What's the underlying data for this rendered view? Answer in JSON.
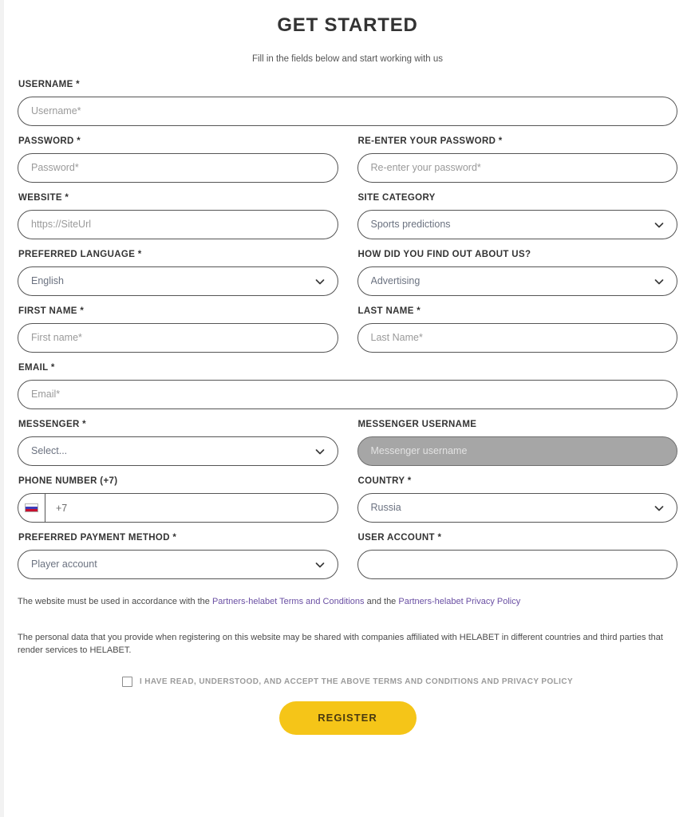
{
  "header": {
    "title": "GET STARTED",
    "subtitle": "Fill in the fields below and start working with us"
  },
  "form": {
    "username": {
      "label": "USERNAME *",
      "placeholder": "Username*",
      "value": ""
    },
    "password": {
      "label": "PASSWORD *",
      "placeholder": "Password*",
      "value": ""
    },
    "password_confirm": {
      "label": "RE-ENTER YOUR PASSWORD *",
      "placeholder": "Re-enter your password*",
      "value": ""
    },
    "website": {
      "label": "WEBSITE *",
      "placeholder": "https://SiteUrl",
      "value": ""
    },
    "site_category": {
      "label": "SITE CATEGORY",
      "value": "Sports predictions",
      "icon": "chevron-down-icon"
    },
    "preferred_language": {
      "label": "PREFERRED LANGUAGE *",
      "value": "English",
      "icon": "chevron-down-icon"
    },
    "find_out": {
      "label": "HOW DID YOU FIND OUT ABOUT US?",
      "value": "Advertising",
      "icon": "chevron-down-icon"
    },
    "first_name": {
      "label": "FIRST NAME *",
      "placeholder": "First name*",
      "value": ""
    },
    "last_name": {
      "label": "LAST NAME *",
      "placeholder": "Last Name*",
      "value": ""
    },
    "email": {
      "label": "EMAIL *",
      "placeholder": "Email*",
      "value": ""
    },
    "messenger": {
      "label": "MESSENGER *",
      "value": "Select...",
      "icon": "chevron-down-icon"
    },
    "messenger_username": {
      "label": "MESSENGER USERNAME",
      "placeholder": "Messenger username",
      "value": "",
      "disabled": true
    },
    "phone": {
      "label": "PHONE NUMBER (+7)",
      "value": "+7",
      "flag": "russia-flag-icon"
    },
    "country": {
      "label": "COUNTRY *",
      "value": "Russia",
      "icon": "chevron-down-icon"
    },
    "payment_method": {
      "label": "PREFERRED PAYMENT METHOD *",
      "value": "Player account",
      "icon": "chevron-down-icon"
    },
    "user_account": {
      "label": "USER ACCOUNT *",
      "placeholder": "",
      "value": ""
    }
  },
  "legal": {
    "line1_part1": "The website must be used in accordance with the ",
    "terms_link": "Partners-helabet Terms and Conditions",
    "line1_part2": " and the ",
    "privacy_link": "Partners-helabet Privacy Policy",
    "line2": "The personal data that you provide when registering on this website may be shared with companies affiliated with HELABET in different countries and third parties that render services to HELABET.",
    "link_color": "#6a4fa3"
  },
  "consent": {
    "label": "I HAVE READ, UNDERSTOOD, AND ACCEPT THE ABOVE TERMS AND CONDITIONS AND PRIVACY POLICY",
    "checked": false
  },
  "submit": {
    "label": "REGISTER",
    "background": "#f5c518",
    "text_color": "#4a3a10"
  }
}
